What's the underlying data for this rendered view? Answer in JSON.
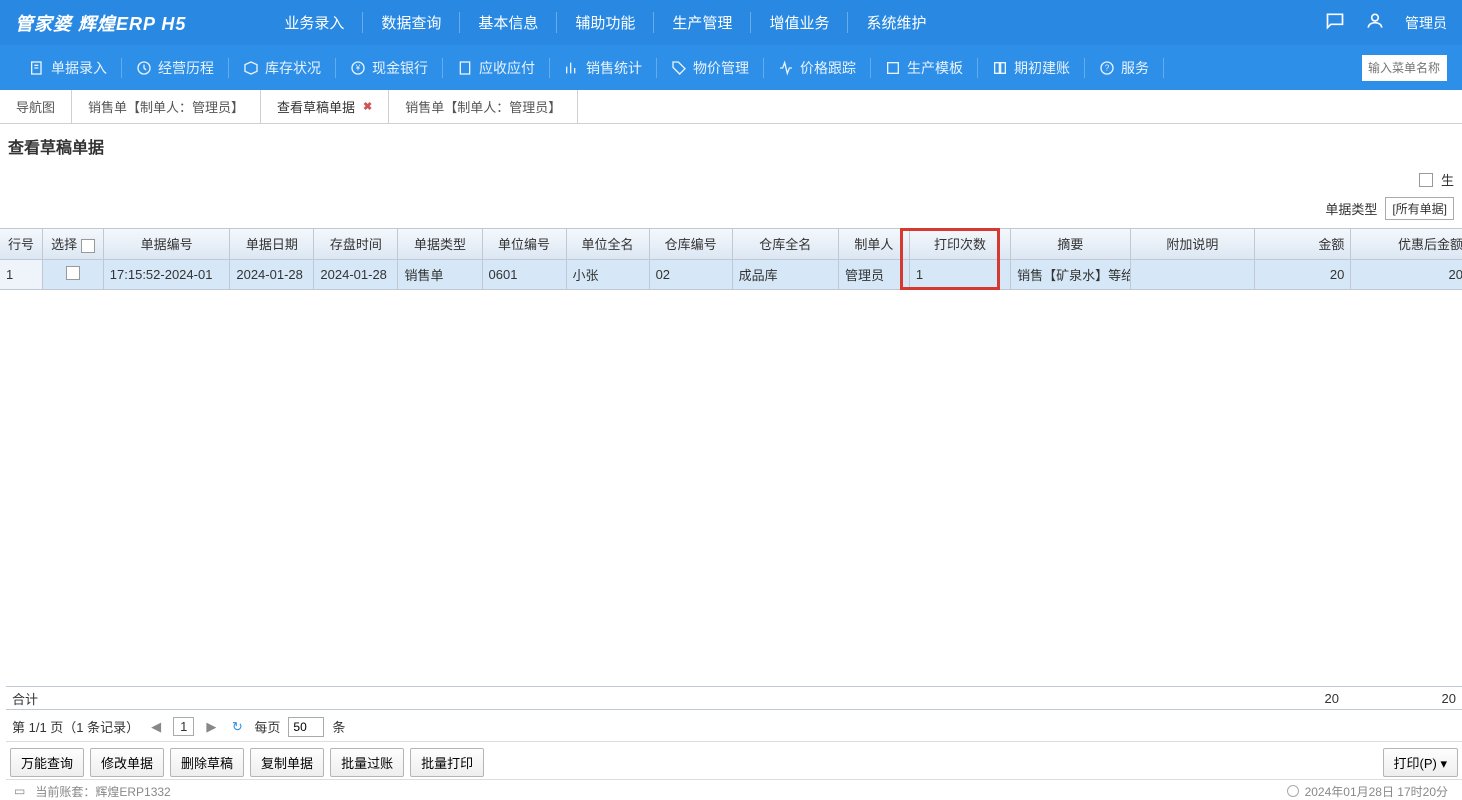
{
  "app": {
    "title": "管家婆 辉煌ERP H5"
  },
  "main_nav": [
    "业务录入",
    "数据查询",
    "基本信息",
    "辅助功能",
    "生产管理",
    "增值业务",
    "系统维护"
  ],
  "header": {
    "user": "管理员"
  },
  "toolbar": [
    "单据录入",
    "经营历程",
    "库存状况",
    "现金银行",
    "应收应付",
    "销售统计",
    "物价管理",
    "价格跟踪",
    "生产模板",
    "期初建账",
    "服务"
  ],
  "search": {
    "placeholder": "输入菜单名称"
  },
  "tabs": [
    {
      "label": "导航图",
      "closable": false
    },
    {
      "label": "销售单【制单人：管理员】",
      "closable": false
    },
    {
      "label": "查看草稿单据",
      "closable": true,
      "active": true
    },
    {
      "label": "销售单【制单人：管理员】",
      "closable": false
    }
  ],
  "page_title": "查看草稿单据",
  "filter": {
    "checkbox_label": "生"
  },
  "type_filter": {
    "label": "单据类型",
    "value": "[所有单据]"
  },
  "columns": [
    "行号",
    "选择",
    "单据编号",
    "单据日期",
    "存盘时间",
    "单据类型",
    "单位编号",
    "单位全名",
    "仓库编号",
    "仓库全名",
    "制单人",
    "打印次数",
    "摘要",
    "附加说明",
    "金额",
    "优惠后金额"
  ],
  "rows": [
    {
      "rownum": "1",
      "docno": "17:15:52-2024-01",
      "date": "2024-01-28",
      "save": "2024-01-28",
      "type": "销售单",
      "unitno": "0601",
      "unitname": "小张",
      "whno": "02",
      "whname": "成品库",
      "maker": "管理员",
      "print": "1",
      "summary": "销售【矿泉水】等给",
      "note": "",
      "amount": "20",
      "after": "20"
    }
  ],
  "sum": {
    "label": "合计",
    "amount": "20",
    "after": "20"
  },
  "pager": {
    "info": "第 1/1 页（1 条记录）",
    "page": "1",
    "perpage_label": "每页",
    "perpage_value": "50",
    "unit": "条"
  },
  "actions": {
    "btns": [
      "万能查询",
      "修改单据",
      "删除草稿",
      "复制单据",
      "批量过账",
      "批量打印"
    ],
    "print": "打印(P)"
  },
  "status": {
    "account_label": "当前账套：",
    "account": "辉煌ERP1332",
    "datetime": "2024年01月28日 17时20分"
  }
}
